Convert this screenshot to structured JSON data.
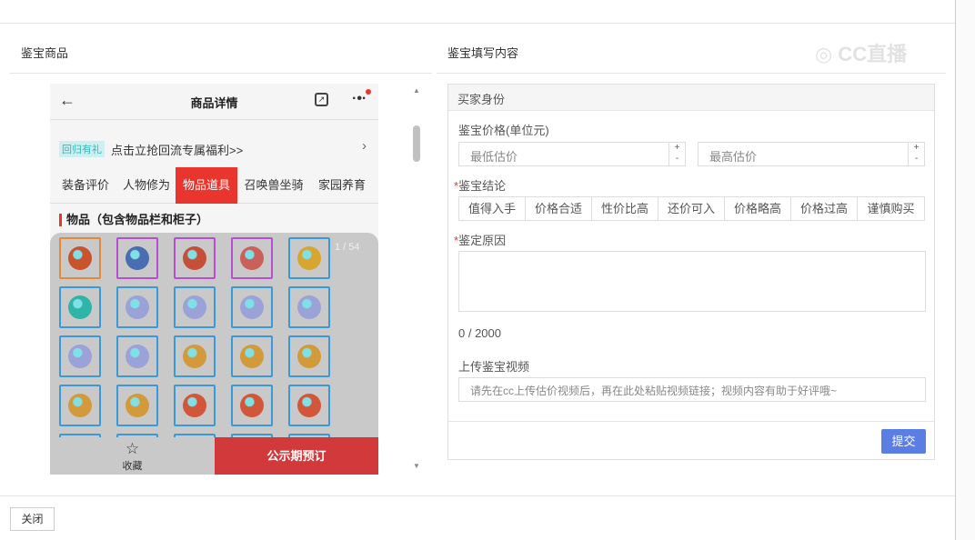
{
  "left_panel": {
    "title": "鉴宝商品"
  },
  "phone": {
    "title": "商品详情",
    "promo_badge": "回归有礼",
    "promo_text": "点击立抢回流专属福利>>",
    "tabs": [
      {
        "label": "装备评价"
      },
      {
        "label": "人物修为"
      },
      {
        "label": "物品道具",
        "active": true
      },
      {
        "label": "召唤兽坐骑"
      },
      {
        "label": "家园养育"
      }
    ],
    "section_title": "物品（包含物品栏和柜子）",
    "page_indicator": "1 / 54",
    "items": [
      {
        "border": "#e08a3c",
        "color": "#c8532c"
      },
      {
        "border": "#b54fd0",
        "color": "#4a6cb0"
      },
      {
        "border": "#b54fd0",
        "color": "#c4503a"
      },
      {
        "border": "#b54fd0",
        "color": "#c9605a"
      },
      {
        "border": "#3a9ad6",
        "color": "#d7a532"
      },
      {
        "border": "#3a9ad6",
        "color": "#2fb4a8"
      },
      {
        "border": "#3a9ad6",
        "color": "#9aa2d8"
      },
      {
        "border": "#3a9ad6",
        "color": "#9aa2d8"
      },
      {
        "border": "#3a9ad6",
        "color": "#9aa2d8"
      },
      {
        "border": "#3a9ad6",
        "color": "#9aa2d8"
      },
      {
        "border": "#3a9ad6",
        "color": "#9aa2d8"
      },
      {
        "border": "#3a9ad6",
        "color": "#9aa2d8"
      },
      {
        "border": "#3a9ad6",
        "color": "#d29a3a"
      },
      {
        "border": "#3a9ad6",
        "color": "#d29a3a"
      },
      {
        "border": "#3a9ad6",
        "color": "#d29a3a"
      },
      {
        "border": "#3a9ad6",
        "color": "#d29a3a"
      },
      {
        "border": "#3a9ad6",
        "color": "#d29a3a"
      },
      {
        "border": "#3a9ad6",
        "color": "#d2563a"
      },
      {
        "border": "#3a9ad6",
        "color": "#d2563a"
      },
      {
        "border": "#3a9ad6",
        "color": "#d2563a"
      }
    ],
    "fav_label": "收藏",
    "buy_label": "公示期预订"
  },
  "right_panel": {
    "title": "鉴宝填写内容",
    "watermark": "CC直播",
    "form_header": "买家身份",
    "price_label": "鉴宝价格(单位元)",
    "min_placeholder": "最低估价",
    "max_placeholder": "最高估价",
    "conclusion_label": "鉴宝结论",
    "conclusions": [
      "值得入手",
      "价格合适",
      "性价比高",
      "还价可入",
      "价格略高",
      "价格过高",
      "谨慎购买"
    ],
    "reason_label": "鉴定原因",
    "reason_count": "0 / 2000",
    "video_label": "上传鉴宝视频",
    "video_placeholder": "请先在cc上传估价视频后，再在此处粘贴视频链接；视频内容有助于好评哦~",
    "submit_label": "提交"
  },
  "footer": {
    "close_label": "关闭"
  },
  "colors": {
    "accent": "#e8362e",
    "submit": "#5b7ee5"
  }
}
